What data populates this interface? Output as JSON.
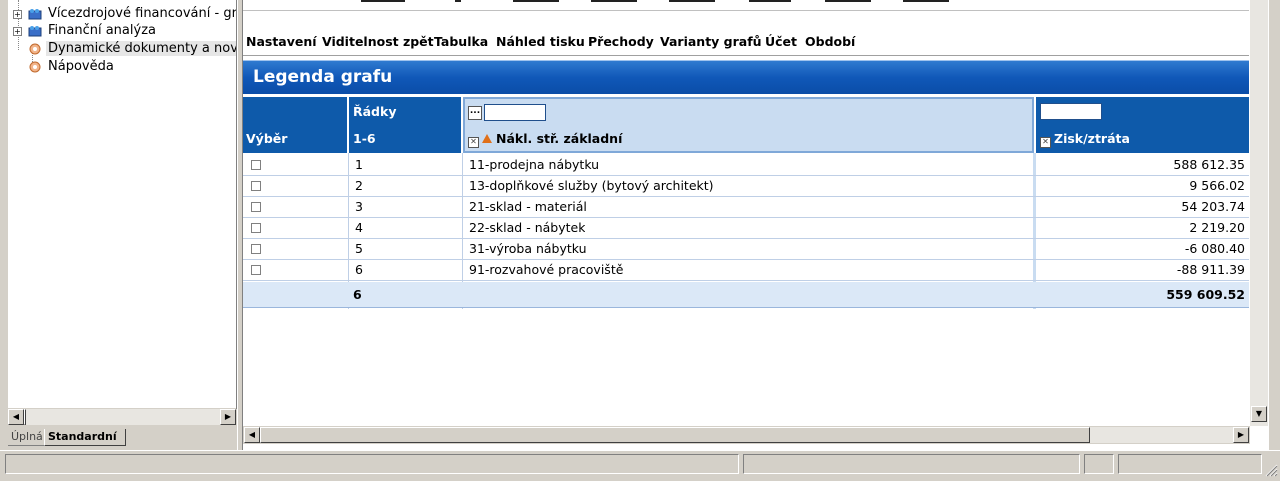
{
  "tree": {
    "items": [
      {
        "label": "Vícezdrojové financování - granty",
        "expandable": true,
        "expand_symbol": "+"
      },
      {
        "label": "Finanční analýza",
        "expandable": true,
        "expand_symbol": "+"
      },
      {
        "label": "Dynamické dokumenty a novinky",
        "expandable": false,
        "selected": true
      },
      {
        "label": "Nápověda",
        "expandable": false
      }
    ],
    "tabs": {
      "full": "Úplná",
      "standard": "Standardní"
    }
  },
  "menu": {
    "items": [
      "Nastavení",
      "Viditelnost zpět",
      "Tabulka",
      "Náhled tisku",
      "Přechody",
      "Varianty grafů",
      "Účet",
      "Období"
    ]
  },
  "legend": {
    "title": "Legenda grafu",
    "columns": {
      "select": "Výběr",
      "rows_top": "Řádky",
      "rows_range": "1-6",
      "cost_center": "Nákl. stř. základní",
      "profit": "Zisk/ztráta",
      "ellipsis": "..."
    },
    "rows": [
      {
        "n": "1",
        "name": "11-prodejna nábytku",
        "value": "588 612.35"
      },
      {
        "n": "2",
        "name": "13-doplňkové služby (bytový architekt)",
        "value": "9 566.02"
      },
      {
        "n": "3",
        "name": "21-sklad - materiál",
        "value": "54 203.74"
      },
      {
        "n": "4",
        "name": "22-sklad - nábytek",
        "value": "2 219.20"
      },
      {
        "n": "5",
        "name": "31-výroba nábytku",
        "value": "-6 080.40"
      },
      {
        "n": "6",
        "name": "91-rozvahové pracoviště",
        "value": "-88 911.39"
      }
    ],
    "total": {
      "count": "6",
      "value": "559 609.52"
    }
  },
  "colors": {
    "header_blue": "#0e5aaa",
    "header_light": "#c9dcf1",
    "title_gradient_top": "#2f7ad0",
    "sort_arrow": "#e0701a"
  }
}
